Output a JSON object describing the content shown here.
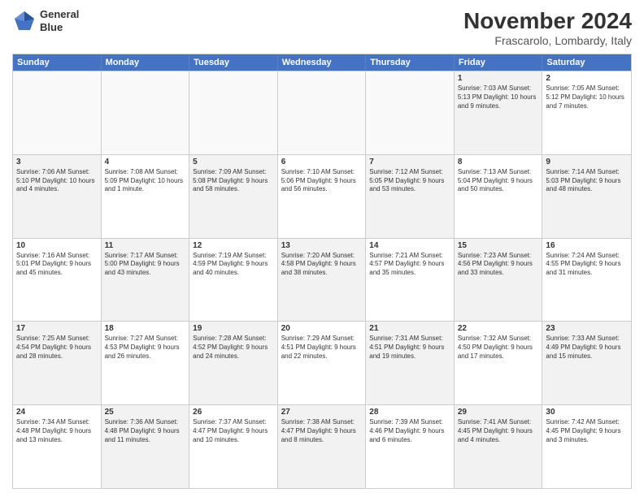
{
  "logo": {
    "line1": "General",
    "line2": "Blue"
  },
  "title": "November 2024",
  "location": "Frascarolo, Lombardy, Italy",
  "days_of_week": [
    "Sunday",
    "Monday",
    "Tuesday",
    "Wednesday",
    "Thursday",
    "Friday",
    "Saturday"
  ],
  "weeks": [
    [
      {
        "day": "",
        "info": ""
      },
      {
        "day": "",
        "info": ""
      },
      {
        "day": "",
        "info": ""
      },
      {
        "day": "",
        "info": ""
      },
      {
        "day": "",
        "info": ""
      },
      {
        "day": "1",
        "info": "Sunrise: 7:03 AM\nSunset: 5:13 PM\nDaylight: 10 hours\nand 9 minutes."
      },
      {
        "day": "2",
        "info": "Sunrise: 7:05 AM\nSunset: 5:12 PM\nDaylight: 10 hours\nand 7 minutes."
      }
    ],
    [
      {
        "day": "3",
        "info": "Sunrise: 7:06 AM\nSunset: 5:10 PM\nDaylight: 10 hours\nand 4 minutes."
      },
      {
        "day": "4",
        "info": "Sunrise: 7:08 AM\nSunset: 5:09 PM\nDaylight: 10 hours\nand 1 minute."
      },
      {
        "day": "5",
        "info": "Sunrise: 7:09 AM\nSunset: 5:08 PM\nDaylight: 9 hours\nand 58 minutes."
      },
      {
        "day": "6",
        "info": "Sunrise: 7:10 AM\nSunset: 5:06 PM\nDaylight: 9 hours\nand 56 minutes."
      },
      {
        "day": "7",
        "info": "Sunrise: 7:12 AM\nSunset: 5:05 PM\nDaylight: 9 hours\nand 53 minutes."
      },
      {
        "day": "8",
        "info": "Sunrise: 7:13 AM\nSunset: 5:04 PM\nDaylight: 9 hours\nand 50 minutes."
      },
      {
        "day": "9",
        "info": "Sunrise: 7:14 AM\nSunset: 5:03 PM\nDaylight: 9 hours\nand 48 minutes."
      }
    ],
    [
      {
        "day": "10",
        "info": "Sunrise: 7:16 AM\nSunset: 5:01 PM\nDaylight: 9 hours\nand 45 minutes."
      },
      {
        "day": "11",
        "info": "Sunrise: 7:17 AM\nSunset: 5:00 PM\nDaylight: 9 hours\nand 43 minutes."
      },
      {
        "day": "12",
        "info": "Sunrise: 7:19 AM\nSunset: 4:59 PM\nDaylight: 9 hours\nand 40 minutes."
      },
      {
        "day": "13",
        "info": "Sunrise: 7:20 AM\nSunset: 4:58 PM\nDaylight: 9 hours\nand 38 minutes."
      },
      {
        "day": "14",
        "info": "Sunrise: 7:21 AM\nSunset: 4:57 PM\nDaylight: 9 hours\nand 35 minutes."
      },
      {
        "day": "15",
        "info": "Sunrise: 7:23 AM\nSunset: 4:56 PM\nDaylight: 9 hours\nand 33 minutes."
      },
      {
        "day": "16",
        "info": "Sunrise: 7:24 AM\nSunset: 4:55 PM\nDaylight: 9 hours\nand 31 minutes."
      }
    ],
    [
      {
        "day": "17",
        "info": "Sunrise: 7:25 AM\nSunset: 4:54 PM\nDaylight: 9 hours\nand 28 minutes."
      },
      {
        "day": "18",
        "info": "Sunrise: 7:27 AM\nSunset: 4:53 PM\nDaylight: 9 hours\nand 26 minutes."
      },
      {
        "day": "19",
        "info": "Sunrise: 7:28 AM\nSunset: 4:52 PM\nDaylight: 9 hours\nand 24 minutes."
      },
      {
        "day": "20",
        "info": "Sunrise: 7:29 AM\nSunset: 4:51 PM\nDaylight: 9 hours\nand 22 minutes."
      },
      {
        "day": "21",
        "info": "Sunrise: 7:31 AM\nSunset: 4:51 PM\nDaylight: 9 hours\nand 19 minutes."
      },
      {
        "day": "22",
        "info": "Sunrise: 7:32 AM\nSunset: 4:50 PM\nDaylight: 9 hours\nand 17 minutes."
      },
      {
        "day": "23",
        "info": "Sunrise: 7:33 AM\nSunset: 4:49 PM\nDaylight: 9 hours\nand 15 minutes."
      }
    ],
    [
      {
        "day": "24",
        "info": "Sunrise: 7:34 AM\nSunset: 4:48 PM\nDaylight: 9 hours\nand 13 minutes."
      },
      {
        "day": "25",
        "info": "Sunrise: 7:36 AM\nSunset: 4:48 PM\nDaylight: 9 hours\nand 11 minutes."
      },
      {
        "day": "26",
        "info": "Sunrise: 7:37 AM\nSunset: 4:47 PM\nDaylight: 9 hours\nand 10 minutes."
      },
      {
        "day": "27",
        "info": "Sunrise: 7:38 AM\nSunset: 4:47 PM\nDaylight: 9 hours\nand 8 minutes."
      },
      {
        "day": "28",
        "info": "Sunrise: 7:39 AM\nSunset: 4:46 PM\nDaylight: 9 hours\nand 6 minutes."
      },
      {
        "day": "29",
        "info": "Sunrise: 7:41 AM\nSunset: 4:45 PM\nDaylight: 9 hours\nand 4 minutes."
      },
      {
        "day": "30",
        "info": "Sunrise: 7:42 AM\nSunset: 4:45 PM\nDaylight: 9 hours\nand 3 minutes."
      }
    ]
  ]
}
